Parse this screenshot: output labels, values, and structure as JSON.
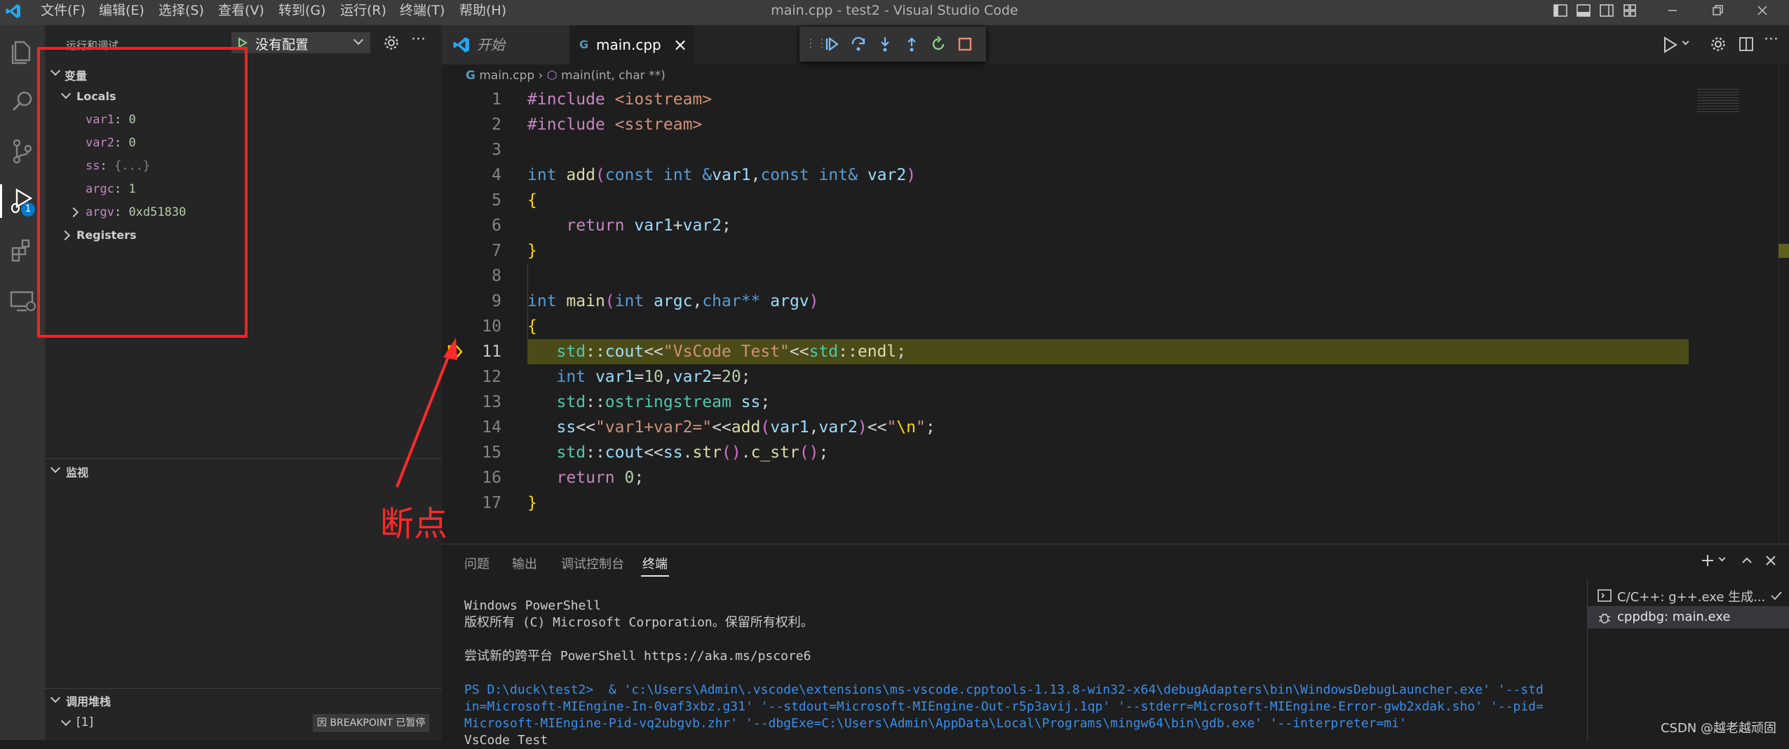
{
  "titlebar": {
    "menus": [
      "文件(F)",
      "编辑(E)",
      "选择(S)",
      "查看(V)",
      "转到(G)",
      "运行(R)",
      "终端(T)",
      "帮助(H)"
    ],
    "title": "main.cpp - test2 - Visual Studio Code"
  },
  "activity": {
    "debug_badge": "1"
  },
  "sidebar": {
    "header": "运行和调试",
    "config": "没有配置",
    "variables_title": "变量",
    "locals_label": "Locals",
    "locals": [
      {
        "name": "var1",
        "value": "0"
      },
      {
        "name": "var2",
        "value": "0"
      },
      {
        "name": "ss",
        "value": "{...}"
      },
      {
        "name": "argc",
        "value": "1"
      },
      {
        "name": "argv",
        "value": "0xd51830"
      }
    ],
    "registers_label": "Registers",
    "watch_title": "监视",
    "callstack_title": "调用堆栈",
    "thread_label": "[1]",
    "breakpoint_badge": "因 BREAKPOINT 已暂停"
  },
  "annotation": {
    "label": "断点",
    "color": "#ff2a2a"
  },
  "editor": {
    "tabs": [
      {
        "label": "开始"
      },
      {
        "label": "main.cpp",
        "close": "×"
      }
    ],
    "breadcrumb": {
      "file": "main.cpp",
      "symbol": "main(int, char **)"
    },
    "line_numbers": [
      "1",
      "2",
      "3",
      "4",
      "5",
      "6",
      "7",
      "8",
      "9",
      "10",
      "11",
      "12",
      "13",
      "14",
      "15",
      "16",
      "17"
    ],
    "current_line": "11"
  },
  "panel": {
    "tabs": [
      "问题",
      "输出",
      "调试控制台",
      "终端"
    ],
    "active_tab": "终端",
    "terminal_lines": [
      "Windows PowerShell",
      "版权所有 (C) Microsoft Corporation。保留所有权利。",
      "",
      "尝试新的跨平台 PowerShell https://aka.ms/pscore6",
      "",
      "PS D:\\duck\\test2>  & 'c:\\Users\\Admin\\.vscode\\extensions\\ms-vscode.cpptools-1.13.8-win32-x64\\debugAdapters\\bin\\WindowsDebugLauncher.exe' '--std",
      "in=Microsoft-MIEngine-In-0vaf3xbz.g31' '--stdout=Microsoft-MIEngine-Out-r5p3avij.1qp' '--stderr=Microsoft-MIEngine-Error-gwb2xdak.sho' '--pid=",
      "Microsoft-MIEngine-Pid-vq2ubgvb.zhr' '--dbgExe=C:\\Users\\Admin\\AppData\\Local\\Programs\\mingw64\\bin\\gdb.exe' '--interpreter=mi'",
      "VsCode Test"
    ],
    "terminals": [
      {
        "label": "C/C++: g++.exe 生成..."
      },
      {
        "label": "cppdbg: main.exe"
      }
    ]
  },
  "watermark": "CSDN @越老越顽固",
  "colors": {
    "accent": "#007acc",
    "current_line": "#4b4b18",
    "annotation": "#ff1f1f"
  }
}
